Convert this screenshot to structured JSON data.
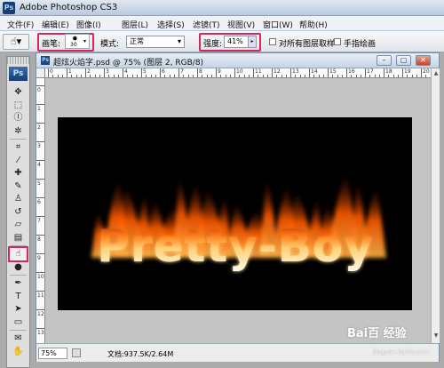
{
  "app": {
    "icon_text": "Ps",
    "title": "Adobe Photoshop CS3"
  },
  "menu": [
    {
      "label": "文件(F)"
    },
    {
      "label": "编辑(E)"
    },
    {
      "label": "图像(I)"
    },
    {
      "label": "图层(L)"
    },
    {
      "label": "选择(S)"
    },
    {
      "label": "滤镜(T)"
    },
    {
      "label": "视图(V)"
    },
    {
      "label": "窗口(W)"
    },
    {
      "label": "帮助(H)"
    }
  ],
  "options": {
    "brush_label": "画笔:",
    "brush_size": "30",
    "mode_label": "模式:",
    "mode_value": "正常",
    "strength_label": "强度:",
    "strength_value": "41%",
    "sample_all_label": "对所有图层取样",
    "finger_paint_label": "手指绘画"
  },
  "toolbox": {
    "logo": "Ps",
    "tools": [
      {
        "name": "move-tool-icon",
        "glyph": "✥"
      },
      {
        "name": "marquee-tool-icon",
        "glyph": "⬚"
      },
      {
        "name": "lasso-tool-icon",
        "glyph": "ⓛ"
      },
      {
        "name": "magic-wand-tool-icon",
        "glyph": "✲"
      },
      {
        "name": "crop-tool-icon",
        "glyph": "⌗"
      },
      {
        "name": "eyedropper-tool-icon",
        "glyph": "⁄"
      },
      {
        "name": "healing-brush-tool-icon",
        "glyph": "✚"
      },
      {
        "name": "brush-tool-icon",
        "glyph": "✎"
      },
      {
        "name": "clone-stamp-tool-icon",
        "glyph": "♙"
      },
      {
        "name": "history-brush-tool-icon",
        "glyph": "↺"
      },
      {
        "name": "eraser-tool-icon",
        "glyph": "▱"
      },
      {
        "name": "gradient-tool-icon",
        "glyph": "▤"
      },
      {
        "name": "smudge-tool-icon",
        "glyph": "☝"
      },
      {
        "name": "dodge-tool-icon",
        "glyph": "●"
      },
      {
        "name": "pen-tool-icon",
        "glyph": "✒"
      },
      {
        "name": "type-tool-icon",
        "glyph": "T"
      },
      {
        "name": "path-selection-tool-icon",
        "glyph": "➤"
      },
      {
        "name": "shape-tool-icon",
        "glyph": "▭"
      },
      {
        "name": "notes-tool-icon",
        "glyph": "✉"
      },
      {
        "name": "hand-tool-icon",
        "glyph": "✋"
      }
    ]
  },
  "document": {
    "title": "超炫火焰字.psd @ 75% (图层 2, RGB/8)",
    "window_buttons": {
      "minimize": "–",
      "maximize": "▢",
      "close": "✕"
    },
    "ruler_numbers": [
      "0",
      "1",
      "2",
      "3",
      "4",
      "5",
      "6",
      "7",
      "8",
      "9",
      "10",
      "11",
      "12",
      "13",
      "14",
      "15",
      "16",
      "17",
      "18",
      "19",
      "20"
    ],
    "canvas_text": "Pretty-Boy",
    "zoom": "75%",
    "doc_size": "文档:937.5K/2.64M"
  },
  "watermark": {
    "logo": "Bai百 经验",
    "sub": "jingyan.baidu.com"
  },
  "colors": {
    "highlight": "#d6275b",
    "flame_core": "#fff3d0",
    "flame_mid": "#ff8a1e",
    "flame_outer": "#b81f00"
  }
}
